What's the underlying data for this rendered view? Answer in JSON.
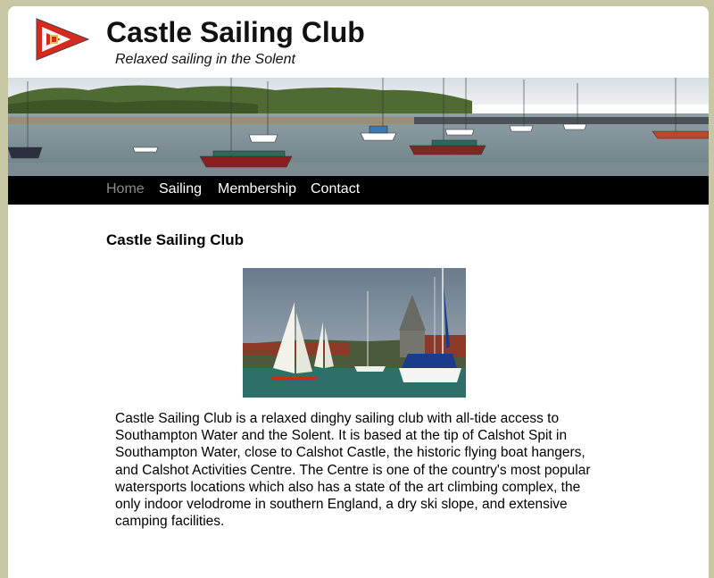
{
  "site": {
    "title": "Castle Sailing Club",
    "tagline": "Relaxed sailing in the Solent",
    "logo_icon": "burgee-flag-icon"
  },
  "nav": {
    "items": [
      {
        "label": "Home",
        "active": true
      },
      {
        "label": "Sailing",
        "active": false
      },
      {
        "label": "Membership",
        "active": false
      },
      {
        "label": "Contact",
        "active": false
      }
    ]
  },
  "main": {
    "heading": "Castle Sailing Club",
    "body": "Castle Sailing Club is a relaxed dinghy sailing club with all-tide access to Southampton Water and the Solent. It is based at the tip of Calshot Spit in Southampton Water, close to Calshot Castle, the historic flying boat hangers, and Calshot Activities Centre. The Centre is one of the country's most popular watersports locations which also has a state of the art climbing complex, the only indoor velodrome in southern England, a dry ski slope, and extensive camping facilities."
  },
  "colors": {
    "page_background": "#c8c7a3",
    "nav_background": "#000000",
    "nav_active": "#8a8a8a",
    "nav_text": "#ffffff",
    "flag_red": "#d8291f"
  }
}
